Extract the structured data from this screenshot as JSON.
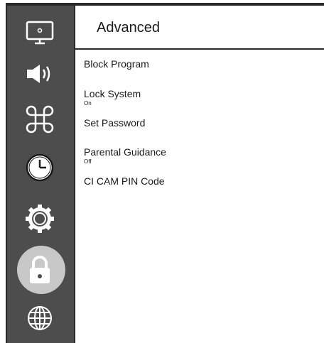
{
  "header": {
    "title": "Advanced"
  },
  "sidebar": {
    "items": [
      {
        "icon": "picture-icon",
        "active": false
      },
      {
        "icon": "sound-icon",
        "active": false
      },
      {
        "icon": "command-icon",
        "active": false
      },
      {
        "icon": "clock-icon",
        "active": false
      },
      {
        "icon": "settings-gear-icon",
        "active": false
      },
      {
        "icon": "lock-icon",
        "active": true
      },
      {
        "icon": "globe-icon",
        "active": false
      }
    ]
  },
  "menu": {
    "items": [
      {
        "label": "Block Program",
        "value": ""
      },
      {
        "label": "Lock System",
        "value": "On"
      },
      {
        "label": "Set Password",
        "value": ""
      },
      {
        "label": "Parental Guidance",
        "value": "Off"
      },
      {
        "label": "CI CAM PIN Code",
        "value": ""
      }
    ]
  },
  "colors": {
    "sidebar_bg": "#4d4d4d",
    "active_highlight": "#c8c8c8",
    "text": "#1a1a1a"
  }
}
